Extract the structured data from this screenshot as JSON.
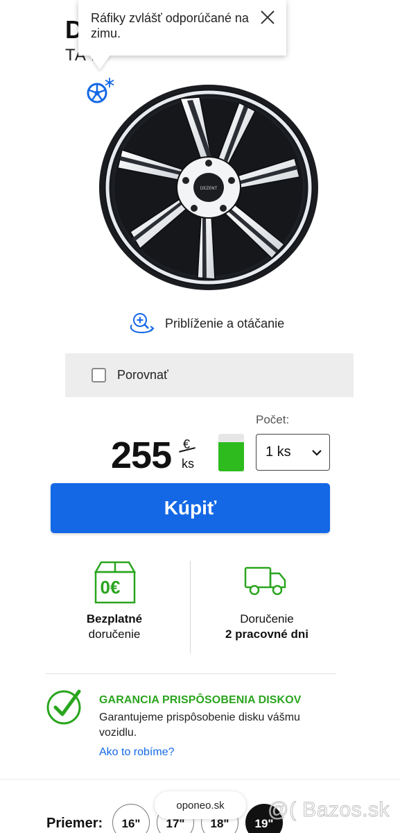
{
  "product": {
    "title_partial": "D",
    "subtitle_partial": "TA   K"
  },
  "tooltip": {
    "text": "Ráfiky zvlášť odporúčané na zimu."
  },
  "zoom_label": "Priblíženie a otáčanie",
  "compare_label": "Porovnať",
  "quantity": {
    "label": "Počet:",
    "selected": "1 ks"
  },
  "price": {
    "amount": "255",
    "currency": "€",
    "unit": "ks"
  },
  "stock_level": 0.78,
  "buy_label": "Kúpiť",
  "free_delivery": {
    "icon_text": "0€",
    "title": "Bezplatné",
    "subtitle": "doručenie"
  },
  "delivery_time": {
    "title": "Doručenie",
    "subtitle": "2 pracovné dni"
  },
  "guarantee": {
    "title": "GARANCIA PRISPÔSOBENIA DISKOV",
    "text": "Garantujeme prispôsobenie disku vášmu vozidlu.",
    "link": "Ako to robíme?"
  },
  "diameter": {
    "label": "Priemer:",
    "options": [
      "16\"",
      "17\"",
      "18\"",
      "19\""
    ],
    "selected_index": 3
  },
  "browser_url": "oponeo.sk",
  "watermark": "@( Bazos.sk",
  "colors": {
    "accent_blue": "#1468e6",
    "green": "#2aa51e",
    "stock_green": "#2dbb1e"
  }
}
